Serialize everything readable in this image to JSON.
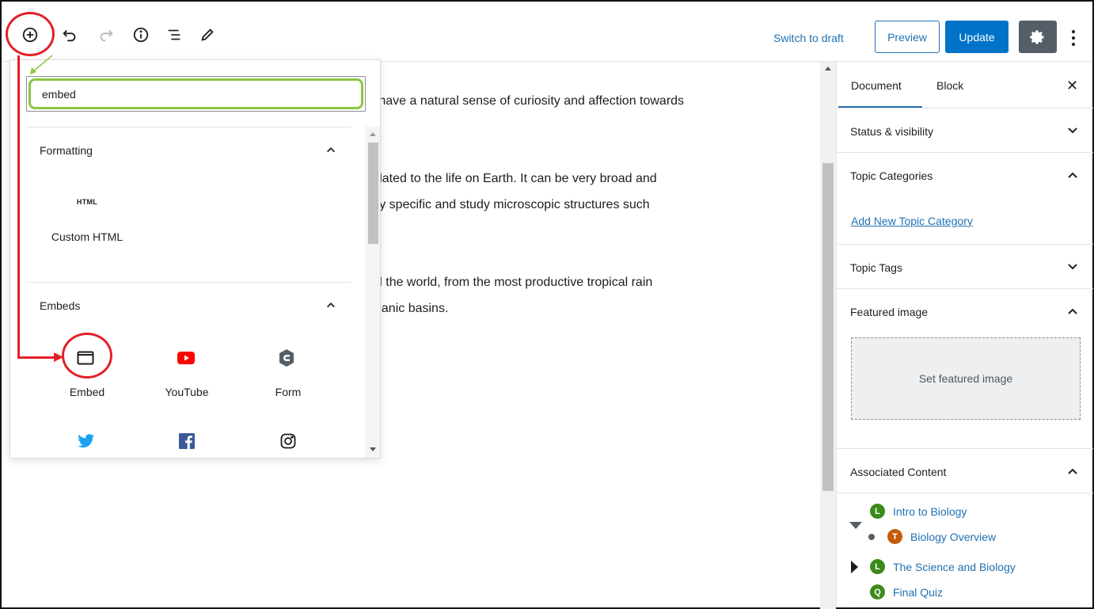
{
  "toolbar": {
    "switch_draft": "Switch to draft",
    "preview": "Preview",
    "update": "Update"
  },
  "content": {
    "line1": "e have a natural sense of curiosity and affection towards",
    "line2": "related to the life on Earth. It can be very broad and",
    "line3": "ery specific and study microscopic structures such",
    "line4": "nd the world, from the most productive tropical rain",
    "line5": "ceanic basins."
  },
  "inserter": {
    "search_value": "embed",
    "sections": [
      {
        "title": "Formatting",
        "items": [
          {
            "label": "Custom HTML",
            "icon": "HTML"
          }
        ]
      },
      {
        "title": "Embeds",
        "items": [
          {
            "label": "Embed",
            "icon": "embed-icon"
          },
          {
            "label": "YouTube",
            "icon": "youtube-icon"
          },
          {
            "label": "Form",
            "icon": "form-icon"
          },
          {
            "label": "",
            "icon": "twitter-icon"
          },
          {
            "label": "",
            "icon": "facebook-icon"
          },
          {
            "label": "",
            "icon": "instagram-icon"
          }
        ]
      }
    ]
  },
  "sidebar": {
    "tabs": [
      "Document",
      "Block"
    ],
    "panels": {
      "status": "Status & visibility",
      "topic_categories": "Topic Categories",
      "add_topic_category": "Add New Topic Category",
      "topic_tags": "Topic Tags",
      "featured_image": "Featured image",
      "set_featured_image": "Set featured image",
      "associated_content": "Associated Content"
    },
    "associated": [
      {
        "badge": "L",
        "label": "Intro to Biology"
      },
      {
        "badge": "T",
        "label": "Biology Overview"
      },
      {
        "badge": "L",
        "label": "The Science and Biology"
      },
      {
        "badge": "Q",
        "label": "Final Quiz"
      }
    ]
  },
  "colors": {
    "accent": "#2271b1",
    "update_bg": "#0073c8",
    "annotation_red": "#e3202a",
    "search_highlight": "#8cc63f",
    "youtube_red": "#ff0000",
    "twitter_blue": "#1da1f2",
    "facebook_blue": "#3b5998",
    "badge_green": "#3c8a1a",
    "badge_orange": "#c45a0a"
  }
}
